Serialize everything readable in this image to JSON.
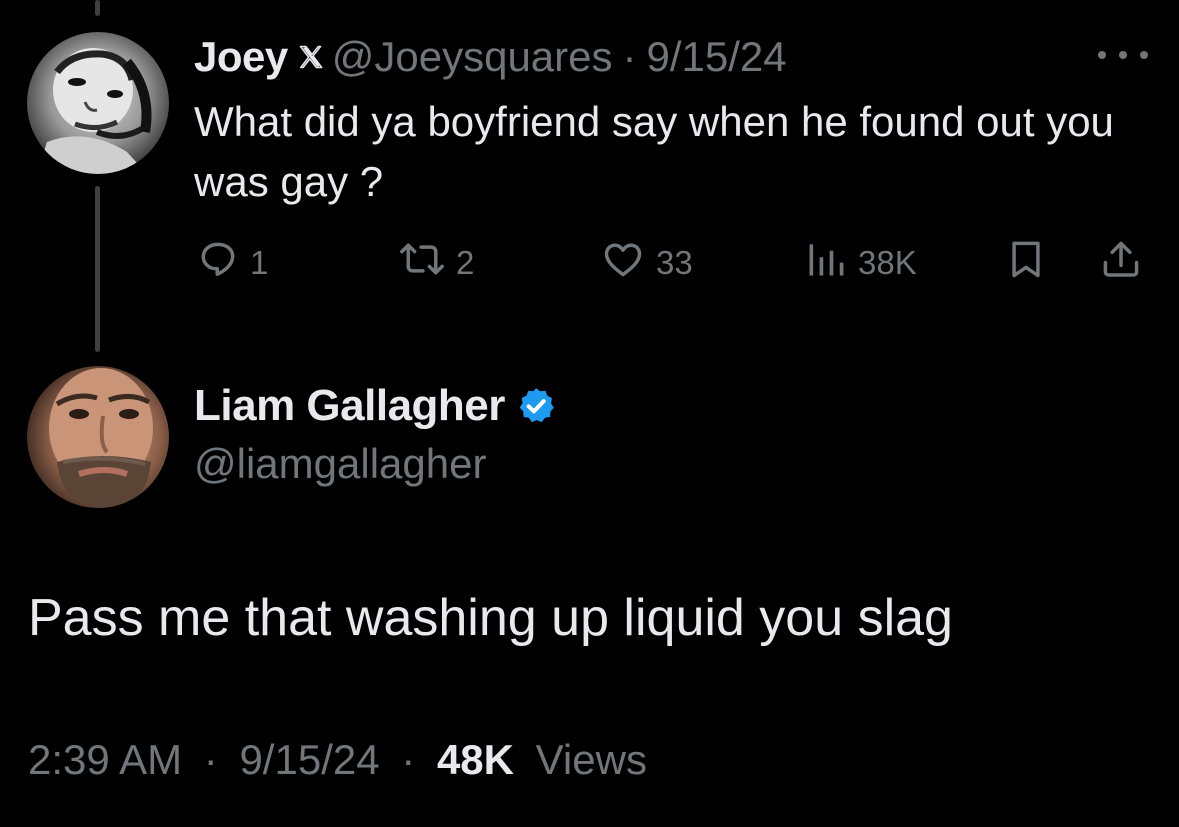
{
  "original_tweet": {
    "display_name": "Joey",
    "handle": "@Joeysquares",
    "separator": "·",
    "date": "9/15/24",
    "text": "What did ya boyfriend say when he found out you was gay ?",
    "icons": {
      "badge": "x-logo-icon",
      "more": "more-options-icon",
      "reply": "reply-icon",
      "retweet": "retweet-icon",
      "like": "heart-icon",
      "views": "views-chart-icon",
      "bookmark": "bookmark-icon",
      "share": "share-icon"
    },
    "stats": {
      "replies": "1",
      "retweets": "2",
      "likes": "33",
      "views": "38K"
    }
  },
  "reply_tweet": {
    "display_name": "Liam Gallagher",
    "handle": "@liamgallagher",
    "verified_icon": "verified-badge-icon",
    "text": "Pass me that washing up liquid you slag",
    "time": "2:39 AM",
    "separator": "·",
    "date": "9/15/24",
    "views_count": "48K",
    "views_label": "Views"
  },
  "colors": {
    "background": "#000000",
    "primary_text": "#e7e9ea",
    "secondary_text": "#71767b",
    "thread_line": "#3e4144",
    "verified_blue": "#1d9bf0"
  }
}
